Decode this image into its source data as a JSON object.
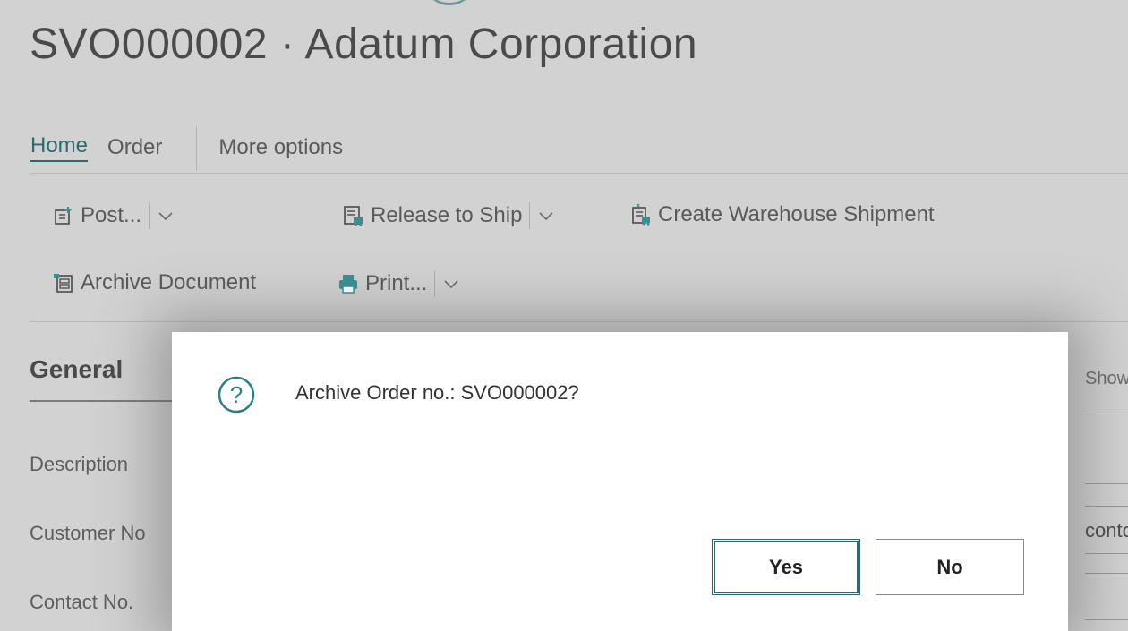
{
  "page": {
    "title": "SVO000002 · Adatum Corporation"
  },
  "tabs": [
    {
      "label": "Home",
      "active": true
    },
    {
      "label": "Order"
    },
    {
      "label": "More options"
    }
  ],
  "actions": {
    "post": "Post...",
    "release_to_ship": "Release to Ship",
    "create_warehouse_shipment": "Create Warehouse Shipment",
    "archive_document": "Archive Document",
    "print": "Print..."
  },
  "section": {
    "title": "General",
    "show_more": "Show",
    "fields": [
      "Description",
      "Customer No",
      "Contact No."
    ],
    "customer_value": "conto"
  },
  "dialog": {
    "message": "Archive Order no.: SVO000002?",
    "yes_label": "Yes",
    "no_label": "No"
  },
  "colors": {
    "accent": "#2d6a6f",
    "icon_teal": "#3a8f95",
    "overlay": "#d2d2d2"
  },
  "icons": [
    "post-icon",
    "release-to-ship-icon",
    "warehouse-shipment-icon",
    "archive-icon",
    "print-icon",
    "question-icon",
    "chevron-down-icon"
  ]
}
